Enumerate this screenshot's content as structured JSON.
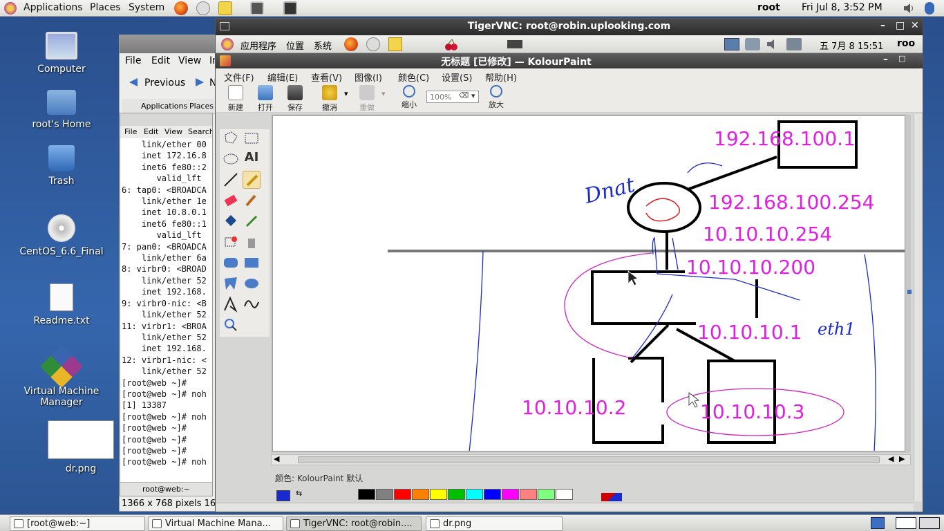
{
  "top_panel": {
    "menus": [
      "Applications",
      "Places",
      "System"
    ],
    "user": "root",
    "clock": "Fri Jul  8,  3:52 PM"
  },
  "desktop": {
    "icons": [
      {
        "label": "Computer",
        "icon": "computer-icon"
      },
      {
        "label": "root's Home",
        "icon": "home-folder-icon"
      },
      {
        "label": "Trash",
        "icon": "trash-icon"
      },
      {
        "label": "CentOS_6.6_Final",
        "icon": "dvd-icon"
      },
      {
        "label": "Readme.txt",
        "icon": "text-file-icon"
      },
      {
        "label": "Virtual Machine Manager",
        "icon": "vmm-icon"
      },
      {
        "label": "dr.png",
        "icon": "image-thumbnail"
      }
    ]
  },
  "image_viewer": {
    "menus": [
      "File",
      "Edit",
      "View",
      "Im"
    ],
    "prev_label": "Previous",
    "next_label": "N",
    "status": "1366 x 768 pixels  16"
  },
  "terminal": {
    "panel_menus": [
      "Applications",
      "Places"
    ],
    "menus": [
      "File",
      "Edit",
      "View",
      "Search"
    ],
    "lines": [
      "    link/ether 00",
      "    inet 172.16.8",
      "    inet6 fe80::2",
      "       valid_lft",
      "6: tap0: <BROADCA",
      "    link/ether 1e",
      "    inet 10.8.0.1",
      "    inet6 fe80::1",
      "       valid_lft",
      "7: pan0: <BROADCA",
      "    link/ether 6a",
      "8: virbr0: <BROAD",
      "    link/ether 52",
      "    inet 192.168.",
      "9: virbr0-nic: <B",
      "    link/ether 52",
      "11: virbr1: <BROA",
      "    link/ether 52",
      "    inet 192.168.",
      "12: virbr1-nic: <",
      "    link/ether 52",
      "[root@web ~]#",
      "[root@web ~]# noh",
      "[1] 13387",
      "[root@web ~]# noh",
      "",
      "[root@web ~]#",
      "[root@web ~]#",
      "[root@web ~]#",
      "[root@web ~]# noh"
    ],
    "tab_label": "root@web:~"
  },
  "vnc": {
    "title": "TigerVNC: root@robin.uplooking.com",
    "remote_panel": {
      "menus": [
        "应用程序",
        "位置",
        "系统"
      ],
      "clock": "五 7月  8 15:51",
      "user": "roo"
    },
    "kolourpaint": {
      "title": "无标题 [已修改] — KolourPaint",
      "menus": [
        "文件(F)",
        "编辑(E)",
        "查看(V)",
        "图像(I)",
        "颜色(C)",
        "设置(S)",
        "帮助(H)"
      ],
      "toolbar": [
        {
          "label": "新建",
          "icon": "new-file-icon"
        },
        {
          "label": "打开",
          "icon": "open-file-icon"
        },
        {
          "label": "保存",
          "icon": "save-icon"
        },
        {
          "label": "撤消",
          "icon": "undo-icon"
        },
        {
          "label": "重做",
          "icon": "redo-icon"
        },
        {
          "label": "缩小",
          "icon": "zoom-out-icon"
        },
        {
          "label": "放大",
          "icon": "zoom-in-icon"
        }
      ],
      "zoom_value": "100%",
      "color_status": "颜色: KolourPaint 默认",
      "palette": [
        "#000000",
        "#808080",
        "#ff0000",
        "#ff8000",
        "#ffff00",
        "#00c000",
        "#00ffff",
        "#0000ff",
        "#ff00ff",
        "#ff8080",
        "#80ff80",
        "#ffffff"
      ]
    },
    "diagram_labels": {
      "ip_1": "192.168.100.1",
      "ip_2": "192.168.100.254",
      "ip_3": "10.10.10.254",
      "ip_4": "10.10.10.200",
      "ip_5": "10.10.10.1",
      "ip_6": "10.10.10.2",
      "ip_7": "10.10.10.3",
      "hand_dnat": "Dnat",
      "hand_eth1": "eth1"
    }
  },
  "taskbar": {
    "tasks": [
      {
        "label": "[root@web:~]",
        "active": false
      },
      {
        "label": "Virtual Machine Mana...",
        "active": false
      },
      {
        "label": "TigerVNC: root@robin....",
        "active": true
      },
      {
        "label": "dr.png",
        "active": false
      }
    ]
  }
}
